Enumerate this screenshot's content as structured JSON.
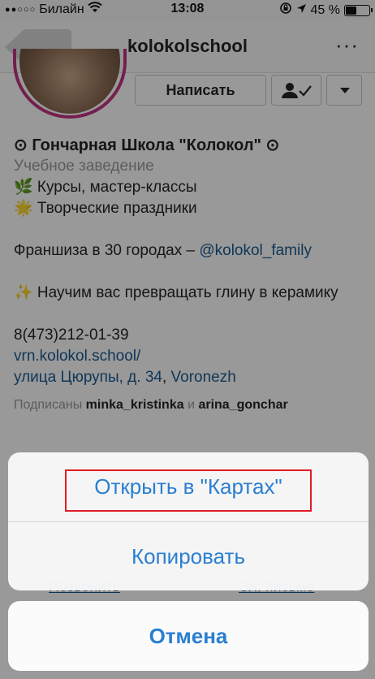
{
  "status": {
    "carrier": "Билайн",
    "time": "13:08",
    "battery": "45 %",
    "battery_level": 0.45
  },
  "nav": {
    "title": "kolokolschool",
    "more": "···"
  },
  "profile": {
    "message_button": "Написать",
    "name": "⊙ Гончарная Школа \"Колокол\" ⊙",
    "category": "Учебное заведение",
    "bio_line1": "🌿 Курсы, мастер-классы",
    "bio_line2": "🌟 Творческие праздники",
    "franchise_text": "Франшиза в 30 городах – ",
    "franchise_link": "@kolokol_family",
    "teach_line": "✨ Научим вас превращать глину в керамику",
    "phone": "8(473)212-01-39",
    "website": "vrn.kolokol.school/",
    "address_link": "улица Цюрупы, д. 34",
    "address_comma": ", ",
    "city_link": "Voronezh",
    "followed_prefix": "Подписаны ",
    "followed_user1": "minka_kristinka",
    "followed_and": " и ",
    "followed_user2": "arina_gonchar"
  },
  "under_sheet": {
    "call": "Позвонить",
    "email": "Эл. письмо"
  },
  "action_sheet": {
    "open_in_maps": "Открыть в \"Картах\"",
    "copy": "Копировать",
    "cancel": "Отмена"
  },
  "colors": {
    "link": "#1c5a8f",
    "sheet_action": "#2a7fd0",
    "highlight": "#e01b24"
  }
}
